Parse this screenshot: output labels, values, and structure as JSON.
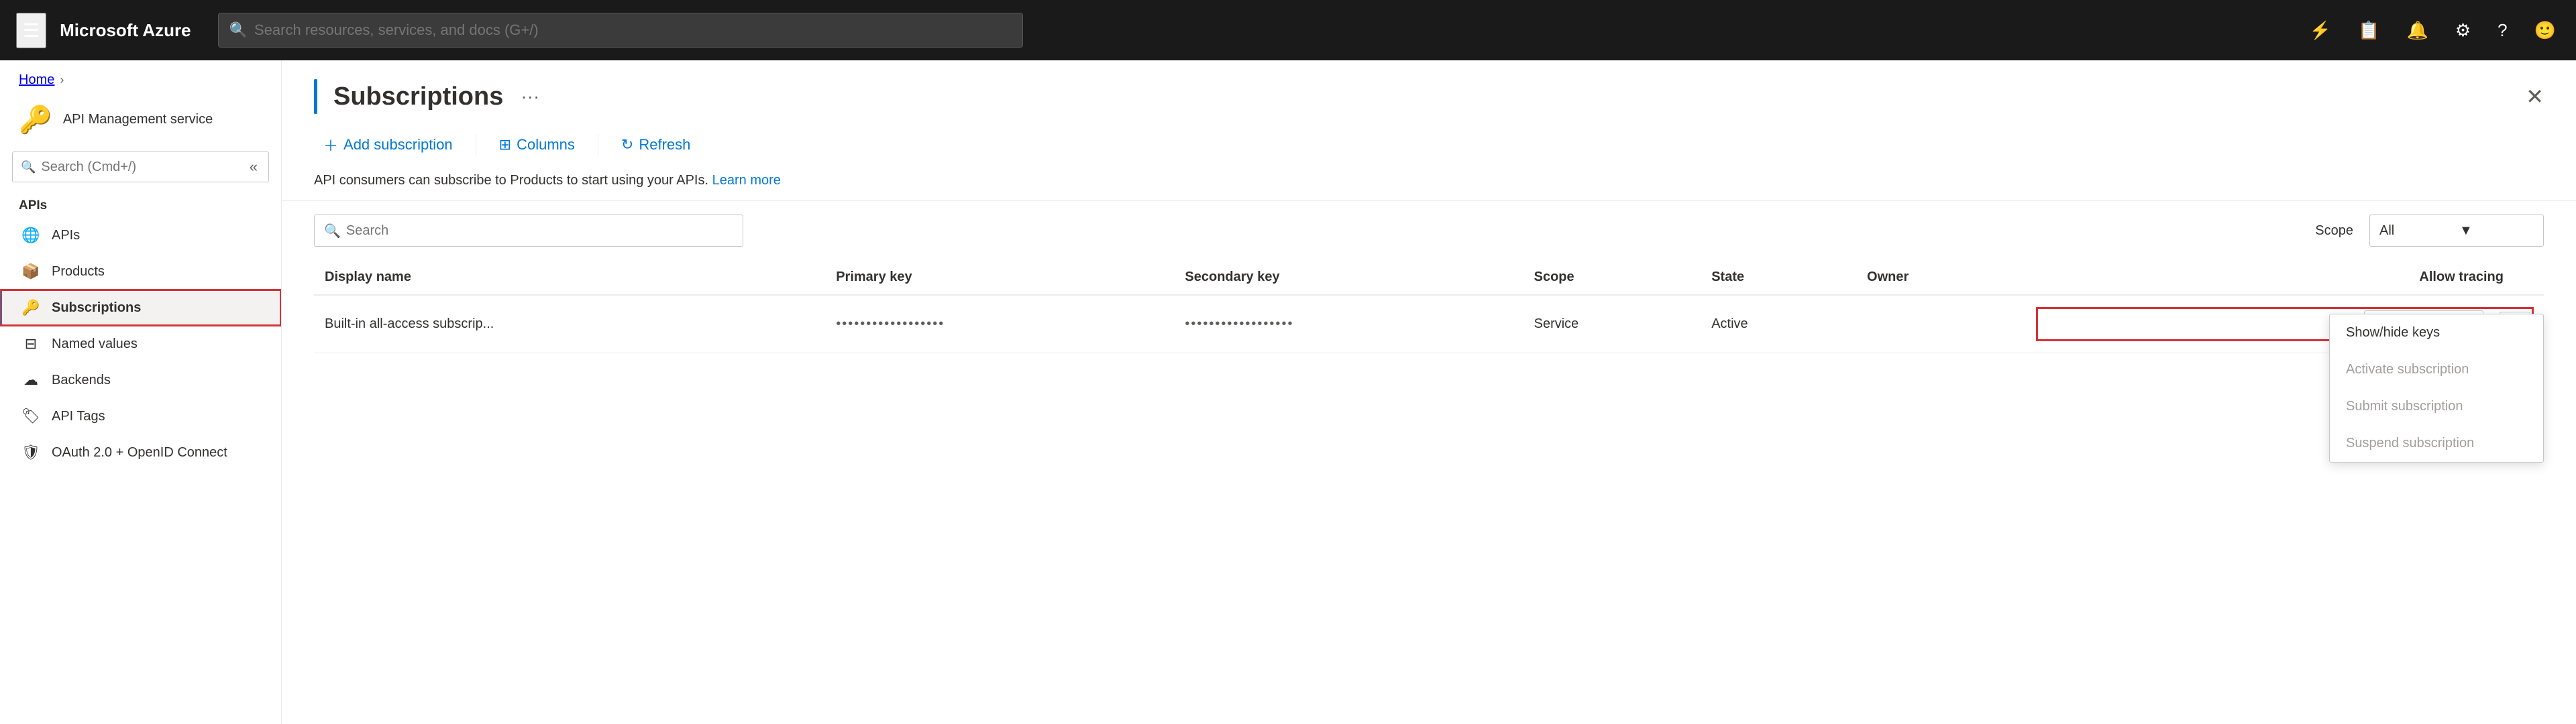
{
  "topbar": {
    "brand": "Microsoft Azure",
    "search_placeholder": "Search resources, services, and docs (G+/)"
  },
  "breadcrumb": {
    "home": "Home"
  },
  "sidebar": {
    "service_icon": "🔑",
    "service_name": "API Management service",
    "search_placeholder": "Search (Cmd+/)",
    "sections": [
      {
        "label": "APIs",
        "items": [
          {
            "id": "apis",
            "label": "APIs",
            "icon": "🌐"
          },
          {
            "id": "products",
            "label": "Products",
            "icon": "📦"
          },
          {
            "id": "subscriptions",
            "label": "Subscriptions",
            "icon": "🔑",
            "active": true
          },
          {
            "id": "named-values",
            "label": "Named values",
            "icon": "⚏"
          },
          {
            "id": "backends",
            "label": "Backends",
            "icon": "☁"
          },
          {
            "id": "api-tags",
            "label": "API Tags",
            "icon": "🏷"
          },
          {
            "id": "oauth",
            "label": "OAuth 2.0 + OpenID Connect",
            "icon": "🛡"
          }
        ]
      }
    ]
  },
  "content": {
    "title": "Subscriptions",
    "toolbar": {
      "add_subscription": "Add subscription",
      "columns": "Columns",
      "refresh": "Refresh"
    },
    "info_text": "API consumers can subscribe to Products to start using your APIs.",
    "learn_more": "Learn more",
    "search_placeholder": "Search",
    "scope_label": "Scope",
    "scope_value": "All",
    "table": {
      "columns": [
        "Display name",
        "Primary key",
        "Secondary key",
        "Scope",
        "State",
        "Owner",
        "Allow tracing"
      ],
      "rows": [
        {
          "display_name": "Built-in all-access subscrip...",
          "primary_key": "••••••••••••••••••",
          "secondary_key": "••••••••••••••••••",
          "scope": "Service",
          "state": "Active",
          "owner": "",
          "allow_tracing": ""
        }
      ]
    },
    "dropdown": {
      "items": [
        {
          "id": "show-hide-keys",
          "label": "Show/hide keys",
          "disabled": false
        },
        {
          "id": "activate-subscription",
          "label": "Activate subscription",
          "disabled": true
        },
        {
          "id": "submit-subscription",
          "label": "Submit subscription",
          "disabled": true
        },
        {
          "id": "suspend-subscription",
          "label": "Suspend subscription",
          "disabled": true
        }
      ]
    }
  }
}
